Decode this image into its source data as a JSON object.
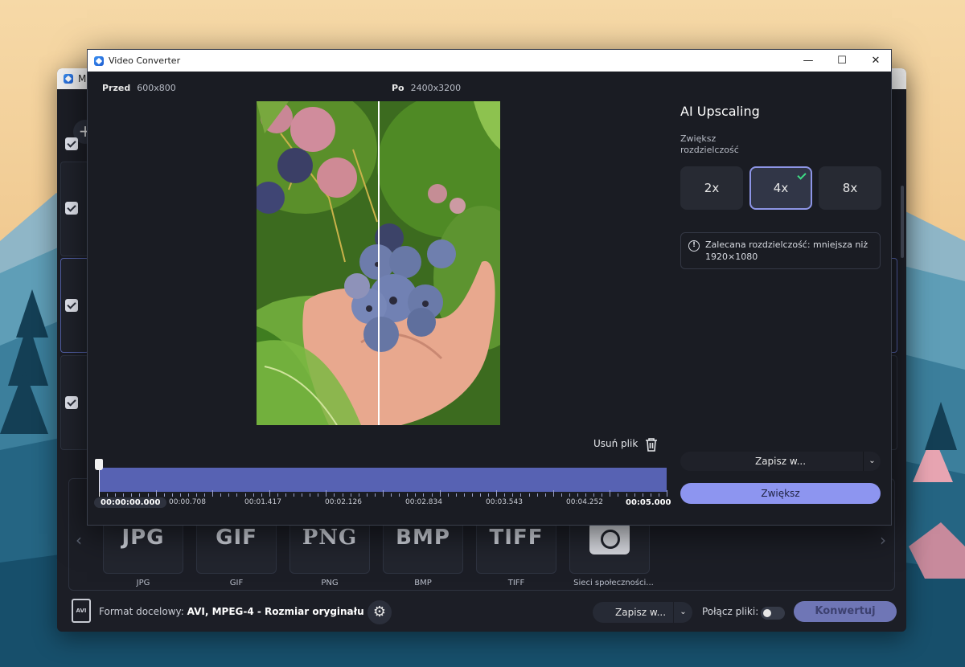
{
  "colors": {
    "accent": "#8d95f0",
    "timeline": "#5762b3",
    "dialog_bg": "#1a1c23",
    "selected_border": "#8d95e6",
    "check_green": "#3ddc84"
  },
  "main_window": {
    "title_partial": "M",
    "add_glyph": "+",
    "formats": [
      {
        "glyph": "JPG",
        "label": "JPG"
      },
      {
        "glyph": "GIF",
        "label": "GIF"
      },
      {
        "glyph": "PNG",
        "label": "PNG"
      },
      {
        "glyph": "BMP",
        "label": "BMP"
      },
      {
        "glyph": "TIFF",
        "label": "TIFF"
      },
      {
        "glyph": "camera-icon",
        "label": "Sieci społeczności..."
      }
    ],
    "nav_prev": "‹",
    "nav_next": "›",
    "avi_icon_text": "AVI",
    "target_format_label": "Format docelowy:",
    "target_format_value": "AVI, MPEG-4 - Rozmiar oryginału",
    "gear_glyph": "⚙",
    "save_label": "Zapisz w...",
    "merge_label": "Połącz pliki:",
    "merge_toggle_on": false,
    "convert_label": "Konwertuj"
  },
  "dialog": {
    "title": "Video Converter",
    "controls": {
      "minimize": "—",
      "maximize": "☐",
      "close": "✕"
    },
    "before_label": "Przed",
    "before_size": "600x800",
    "after_label": "Po",
    "after_size": "2400x3200",
    "remove_file": "Usuń plik",
    "timeline": {
      "current_time": "00:00:00.000",
      "labels": [
        "00:00.708",
        "00:01.417",
        "00:02.126",
        "00:02.834",
        "00:03.543",
        "00:04.252"
      ],
      "end_time": "00:05.000",
      "position_fraction": 0.0
    },
    "panel": {
      "title": "AI Upscaling",
      "resolution_label": "Zwiększ rozdzielczość",
      "scales": [
        "2x",
        "4x",
        "8x"
      ],
      "selected_scale": "4x",
      "info_text": "Zalecana rozdzielczość: mniejsza niż 1920×1080",
      "save_label": "Zapisz w...",
      "enlarge_label": "Zwiększ"
    }
  }
}
